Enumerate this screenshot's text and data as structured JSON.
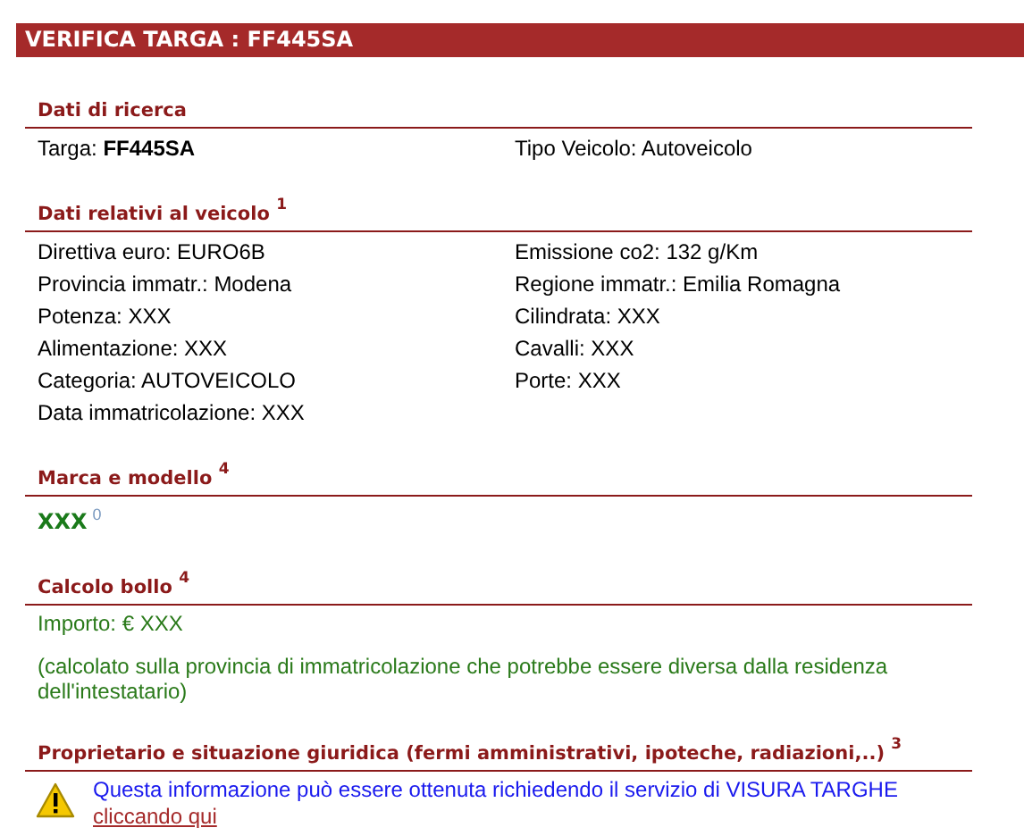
{
  "title": "VERIFICA TARGA : FF445SA",
  "sections": [
    {
      "kind": "fields",
      "heading": "Dati di ricerca",
      "fields": [
        "Targa: **FF445SA**",
        "Tipo Veicolo: Autoveicolo"
      ]
    },
    {
      "kind": "fields",
      "heading": "Dati relativi al veicolo",
      "note": "1",
      "fields": [
        "Direttiva euro: EURO6B",
        "Emissione co2: 132 g/Km",
        "Provincia immatr.: Modena",
        "Regione immatr.: Emilia Romagna",
        "Potenza: XXX",
        "Cilindrata: XXX",
        "Alimentazione: XXX",
        "Cavalli: XXX",
        "Categoria: AUTOVEICOLO",
        "Porte: XXX",
        "Data immatricolazione: XXX"
      ]
    },
    {
      "kind": "model",
      "heading": "Marca e modello",
      "note": "4",
      "value": "XXX",
      "value_note": "0"
    },
    {
      "kind": "tax",
      "heading": "Calcolo bollo",
      "note": "4",
      "amount": "Importo: € XXX",
      "remark": "(calcolato sulla provincia di immatricolazione che potrebbe essere diversa dalla residenza dell'intestatario)"
    },
    {
      "kind": "notice",
      "heading": "Proprietario e situazione giuridica (fermi amministrativi, ipoteche, radiazioni,..)",
      "note": "3",
      "message": "Questa informazione può essere ottenuta richiedendo il servizio di VISURA TARGHE",
      "link": "cliccando qui"
    }
  ]
}
